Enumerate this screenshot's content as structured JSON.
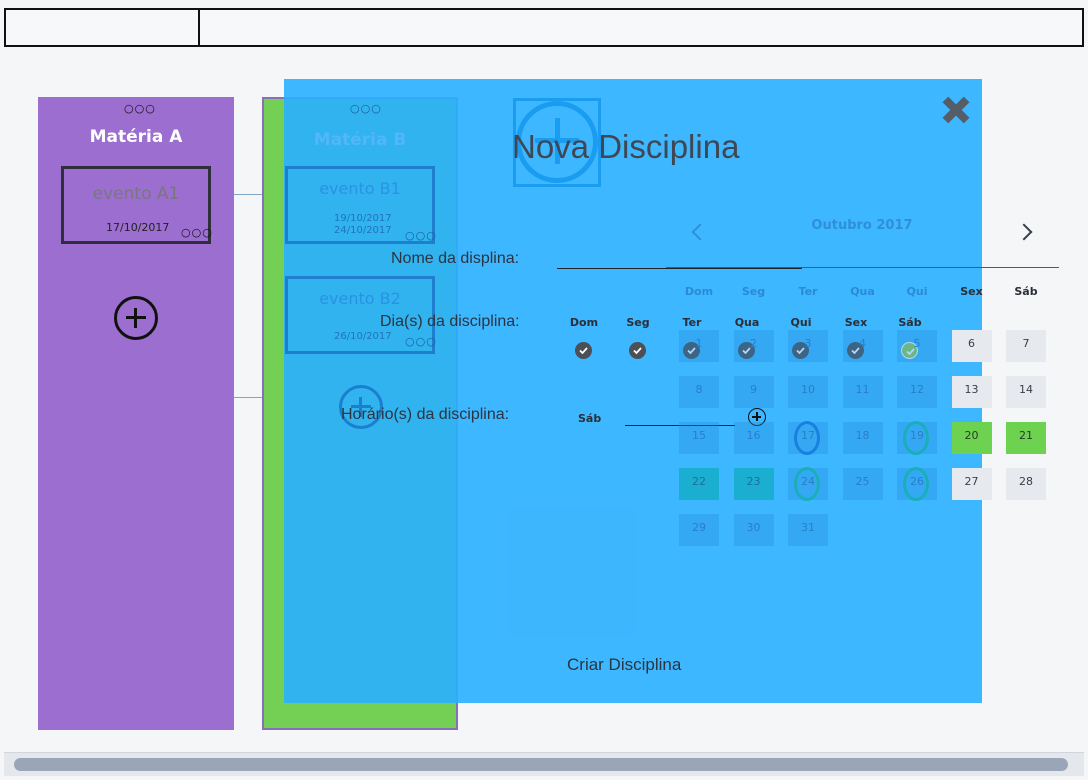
{
  "board": {
    "columns": [
      {
        "title": "Matéria A",
        "events": [
          {
            "name": "evento A1",
            "dates": [
              "17/10/2017"
            ]
          }
        ]
      },
      {
        "title": "Matéria B",
        "events": [
          {
            "name": "evento B1",
            "dates": [
              "19/10/2017",
              "24/10/2017"
            ]
          },
          {
            "name": "evento B2",
            "dates": [
              "26/10/2017"
            ]
          }
        ]
      }
    ]
  },
  "modal": {
    "title": "Nova Disciplina",
    "name_label": "Nome da displina:",
    "name_value": "",
    "days_label": "Dia(s) da disciplina:",
    "days": [
      {
        "label": "Dom",
        "checked": true
      },
      {
        "label": "Seg",
        "checked": true
      },
      {
        "label": "Ter",
        "checked": true
      },
      {
        "label": "Qua",
        "checked": true
      },
      {
        "label": "Qui",
        "checked": true
      },
      {
        "label": "Sex",
        "checked": true
      },
      {
        "label": "Sáb",
        "checked": true,
        "highlight": true
      }
    ],
    "hours_label": "Horário(s) da disciplina:",
    "hours_day": "Sáb",
    "hours_value": "",
    "create_label": "Criar Disciplina"
  },
  "calendar": {
    "month": "Outubro 2017",
    "weekdays": [
      "Dom",
      "Seg",
      "Ter",
      "Qua",
      "Qui",
      "Sex",
      "Sáb"
    ],
    "weeks": [
      [
        "1",
        "2",
        "3",
        "4",
        "5",
        "6",
        "7"
      ],
      [
        "8",
        "9",
        "10",
        "11",
        "12",
        "13",
        "14"
      ],
      [
        "15",
        "16",
        "17",
        "18",
        "19",
        "20",
        "21"
      ],
      [
        "22",
        "23",
        "24",
        "25",
        "26",
        "27",
        "28"
      ],
      [
        "29",
        "30",
        "31",
        "",
        "",
        "",
        ""
      ]
    ],
    "lime_days": [
      "20",
      "21"
    ],
    "teal_days": [
      "22",
      "23"
    ],
    "circled_days": [
      "17",
      "19",
      "24",
      "26"
    ]
  },
  "colors": {
    "column_a": "#9b6ecf",
    "column_b": "#74d055",
    "modal": "#2bb0ff",
    "highlight_green": "#6cd250"
  }
}
